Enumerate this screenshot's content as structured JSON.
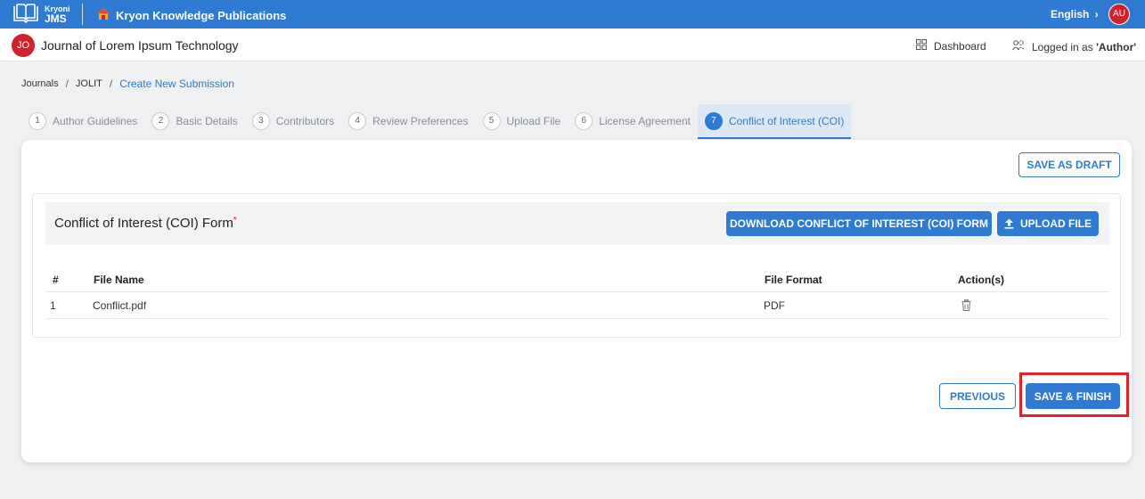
{
  "topbar": {
    "logo_line1": "Kryoni",
    "logo_line2": "JMS",
    "publisher": "Kryon Knowledge Publications",
    "language": "English",
    "user_initials": "AU",
    "bg_color": "#2f7bd3",
    "avatar_color": "#d0222a"
  },
  "subbar": {
    "journal_initials": "JO",
    "journal_title": "Journal of Lorem Ipsum Technology",
    "dashboard_label": "Dashboard",
    "logged_in_prefix": "Logged in as ",
    "logged_in_role": "'Author'"
  },
  "breadcrumb": {
    "items": [
      "Journals",
      "JOLIT"
    ],
    "current": "Create New Submission"
  },
  "steps": [
    {
      "num": "1",
      "label": "Author Guidelines"
    },
    {
      "num": "2",
      "label": "Basic Details"
    },
    {
      "num": "3",
      "label": "Contributors"
    },
    {
      "num": "4",
      "label": "Review Preferences"
    },
    {
      "num": "5",
      "label": "Upload File"
    },
    {
      "num": "6",
      "label": "License Agreement"
    },
    {
      "num": "7",
      "label": "Conflict of Interest (COI)"
    }
  ],
  "active_step": 7,
  "form": {
    "save_draft": "SAVE AS DRAFT",
    "section_title": "Conflict of Interest (COI) Form",
    "required_mark": "*",
    "download_button": "DOWNLOAD CONFLICT OF INTEREST (COI) FORM",
    "upload_button": "UPLOAD FILE",
    "table": {
      "headers": [
        "#",
        "File Name",
        "File Format",
        "Action(s)"
      ],
      "rows": [
        {
          "num": "1",
          "file_name": "Conflict.pdf",
          "format": "PDF",
          "action_icon": "trash-icon"
        }
      ]
    },
    "previous_button": "PREVIOUS",
    "finish_button": "SAVE & FINISH"
  }
}
